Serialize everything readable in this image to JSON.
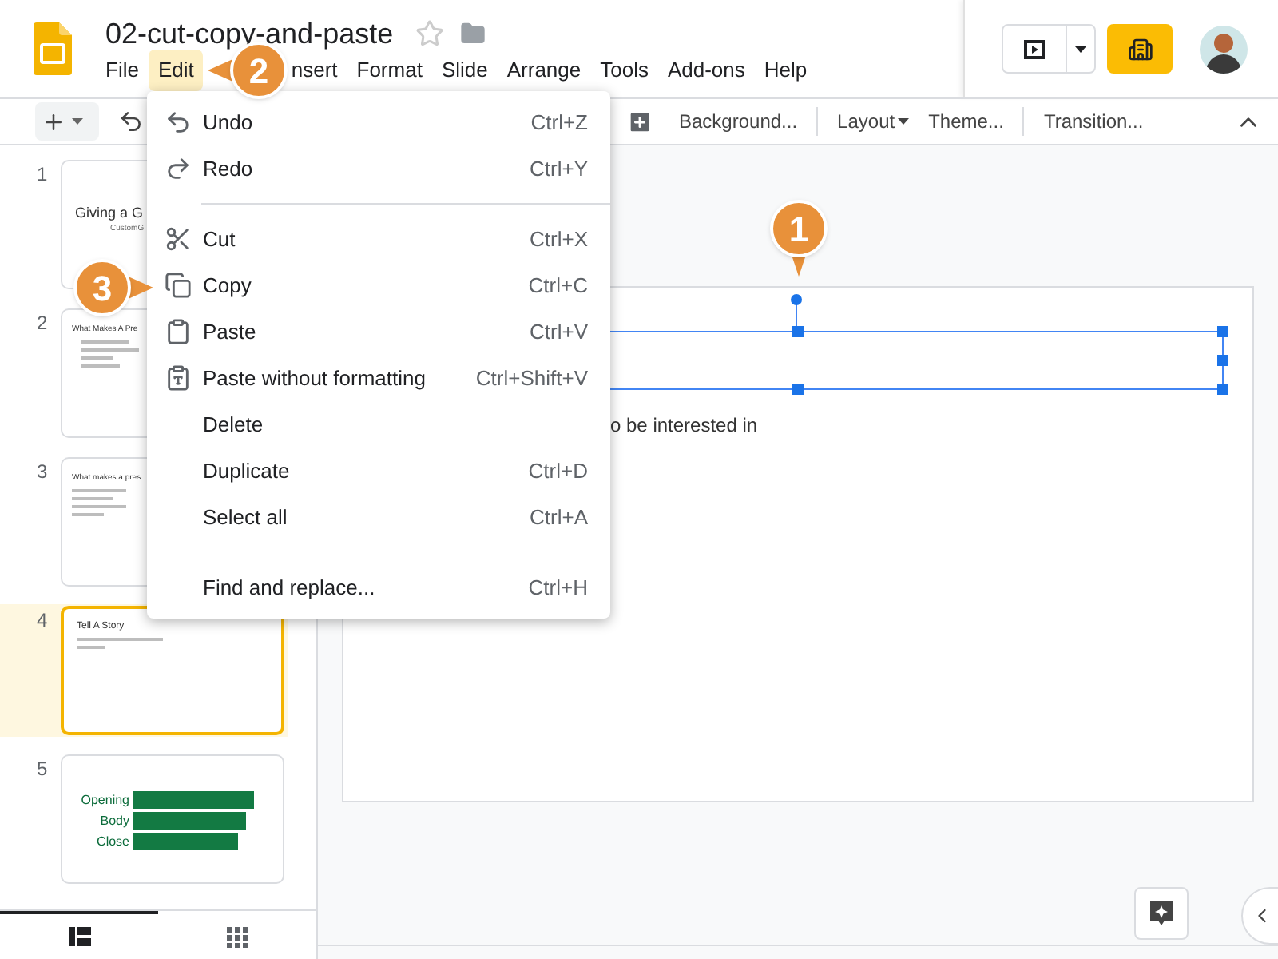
{
  "document": {
    "title": "02-cut-copy-and-paste"
  },
  "menu_bar": [
    {
      "label": "File",
      "selected": false
    },
    {
      "label": "Edit",
      "selected": true
    },
    {
      "label": "nsert",
      "selected": false
    },
    {
      "label": "Format",
      "selected": false
    },
    {
      "label": "Slide",
      "selected": false
    },
    {
      "label": "Arrange",
      "selected": false
    },
    {
      "label": "Tools",
      "selected": false
    },
    {
      "label": "Add-ons",
      "selected": false
    },
    {
      "label": "Help",
      "selected": false
    }
  ],
  "toolbar": [
    {
      "label": "Background...",
      "dropdown": false
    },
    {
      "label": "Layout",
      "dropdown": true
    },
    {
      "label": "Theme...",
      "dropdown": false
    },
    {
      "label": "Transition...",
      "dropdown": false
    }
  ],
  "slides": [
    {
      "number": "1",
      "selected": false,
      "kind": "title",
      "title": "Giving a G",
      "subtitle": "CustomG"
    },
    {
      "number": "2",
      "selected": false,
      "kind": "bullets",
      "title": "What Makes A Pre"
    },
    {
      "number": "3",
      "selected": false,
      "kind": "notes",
      "title": "What makes a pres"
    },
    {
      "number": "4",
      "selected": true,
      "kind": "story",
      "title": "Tell A Story"
    },
    {
      "number": "5",
      "selected": false,
      "kind": "diagram",
      "rows": [
        {
          "label": "Opening"
        },
        {
          "label": "Body"
        },
        {
          "label": "Close"
        }
      ]
    }
  ],
  "panel_views": [
    {
      "kind": "filmstrip",
      "selected": true
    },
    {
      "kind": "grid",
      "selected": false
    }
  ],
  "slide_canvas": {
    "body_text": "o be interested in"
  },
  "edit_menu": [
    {
      "kind": "entry",
      "label": "Undo",
      "shortcut": "Ctrl+Z"
    },
    {
      "kind": "entry",
      "label": "Redo",
      "shortcut": "Ctrl+Y"
    },
    {
      "kind": "rule"
    },
    {
      "kind": "entry",
      "label": "Cut",
      "shortcut": "Ctrl+X"
    },
    {
      "kind": "entry",
      "label": "Copy",
      "shortcut": "Ctrl+C"
    },
    {
      "kind": "entry",
      "label": "Paste",
      "shortcut": "Ctrl+V"
    },
    {
      "kind": "entry",
      "label": "Paste without formatting",
      "shortcut": "Ctrl+Shift+V"
    },
    {
      "kind": "entry",
      "label": "Delete"
    },
    {
      "kind": "entry",
      "label": "Duplicate",
      "shortcut": "Ctrl+D"
    },
    {
      "kind": "entry",
      "label": "Select all",
      "shortcut": "Ctrl+A"
    },
    {
      "kind": "gap"
    },
    {
      "kind": "entry",
      "label": "Find and replace...",
      "shortcut": "Ctrl+H"
    }
  ],
  "callouts": [
    {
      "number": "1"
    },
    {
      "number": "2"
    },
    {
      "number": "3"
    }
  ]
}
